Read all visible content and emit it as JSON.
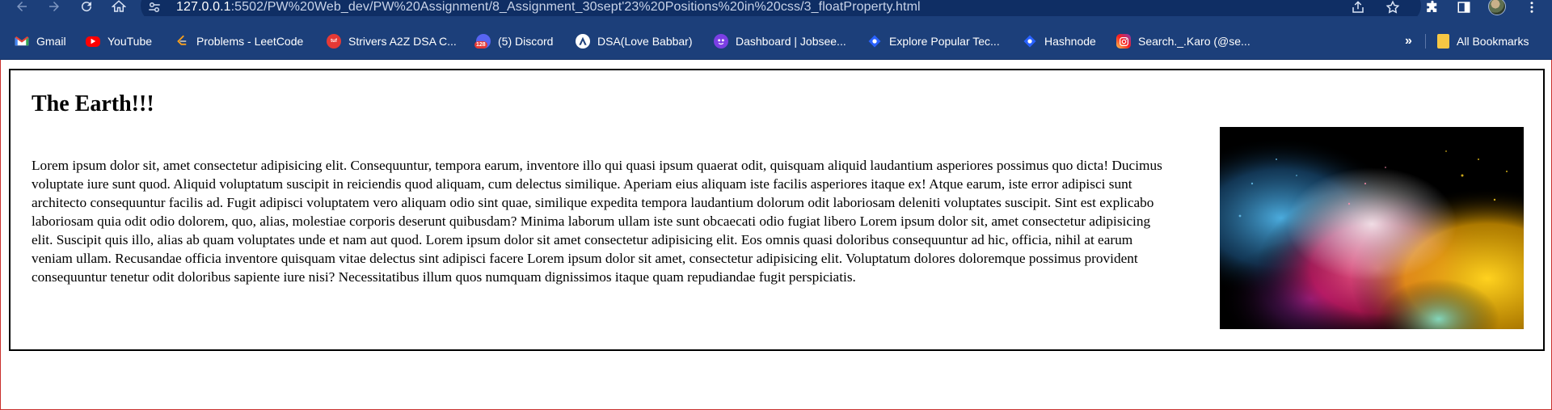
{
  "browser": {
    "url_host": "127.0.0.1",
    "url_rest": ":5502/PW%20Web_dev/PW%20Assignment/8_Assignment_30sept'23%20Positions%20in%20css/3_floatProperty.html",
    "bookmarks": [
      {
        "label": "Gmail",
        "icon": "gmail-icon",
        "color": "#ea4335"
      },
      {
        "label": "YouTube",
        "icon": "youtube-icon",
        "color": "#ff0000"
      },
      {
        "label": "Problems - LeetCode",
        "icon": "leetcode-icon",
        "color": "#f89f1b"
      },
      {
        "label": "Strivers A2Z DSA C...",
        "icon": "takeuforward-icon",
        "color": "#e53935"
      },
      {
        "label": "(5) Discord",
        "icon": "discord-icon",
        "color": "#5865f2",
        "badge": "128"
      },
      {
        "label": "DSA(Love Babbar)",
        "icon": "codehelp-icon",
        "color": "#ffffff"
      },
      {
        "label": "Dashboard | Jobsee...",
        "icon": "jobseeker-icon",
        "color": "#7b3fe4"
      },
      {
        "label": "Explore Popular Tec...",
        "icon": "hashnode-icon",
        "color": "#2962ff"
      },
      {
        "label": "Hashnode",
        "icon": "hashnode-icon",
        "color": "#2962ff"
      },
      {
        "label": "Search._.Karo (@se...",
        "icon": "instagram-icon",
        "color": "#d6249f"
      }
    ],
    "overflow": "»",
    "all_bookmarks": "All Bookmarks"
  },
  "page": {
    "heading": "The Earth!!!",
    "paragraph": "Lorem ipsum dolor sit, amet consectetur adipisicing elit. Consequuntur, tempora earum, inventore illo qui quasi ipsum quaerat odit, quisquam aliquid laudantium asperiores possimus quo dicta! Ducimus voluptate iure sunt quod. Aliquid voluptatum suscipit in reiciendis quod aliquam, cum delectus similique. Aperiam eius aliquam iste facilis asperiores itaque ex! Atque earum, iste error adipisci sunt architecto consequuntur facilis ad. Fugit adipisci voluptatem vero aliquam odio sint quae, similique expedita tempora laudantium dolorum odit laboriosam deleniti voluptates suscipit. Sint est explicabo laboriosam quia odit odio dolorem, quo, alias, molestiae corporis deserunt quibusdam? Minima laborum ullam iste sunt obcaecati odio fugiat libero Lorem ipsum dolor sit, amet consectetur adipisicing elit. Suscipit quis illo, alias ab quam voluptates unde et nam aut quod. Lorem ipsum dolor sit amet consectetur adipisicing elit. Eos omnis quasi doloribus consequuntur ad hic, officia, nihil at earum veniam ullam. Recusandae officia inventore quisquam vitae delectus sint adipisci facere Lorem ipsum dolor sit amet, consectetur adipisicing elit. Voluptatum dolores doloremque possimus provident consequuntur tenetur odit doloribus sapiente iure nisi? Necessitatibus illum quos numquam dignissimos itaque quam repudiandae fugit perspiciatis.",
    "image_icon": "colored-powder-explosion-image"
  },
  "colors": {
    "chrome": "#1c3f7a",
    "omnibox": "#0f2e64",
    "container_border": "#000000",
    "window_border": "#c9302c"
  }
}
